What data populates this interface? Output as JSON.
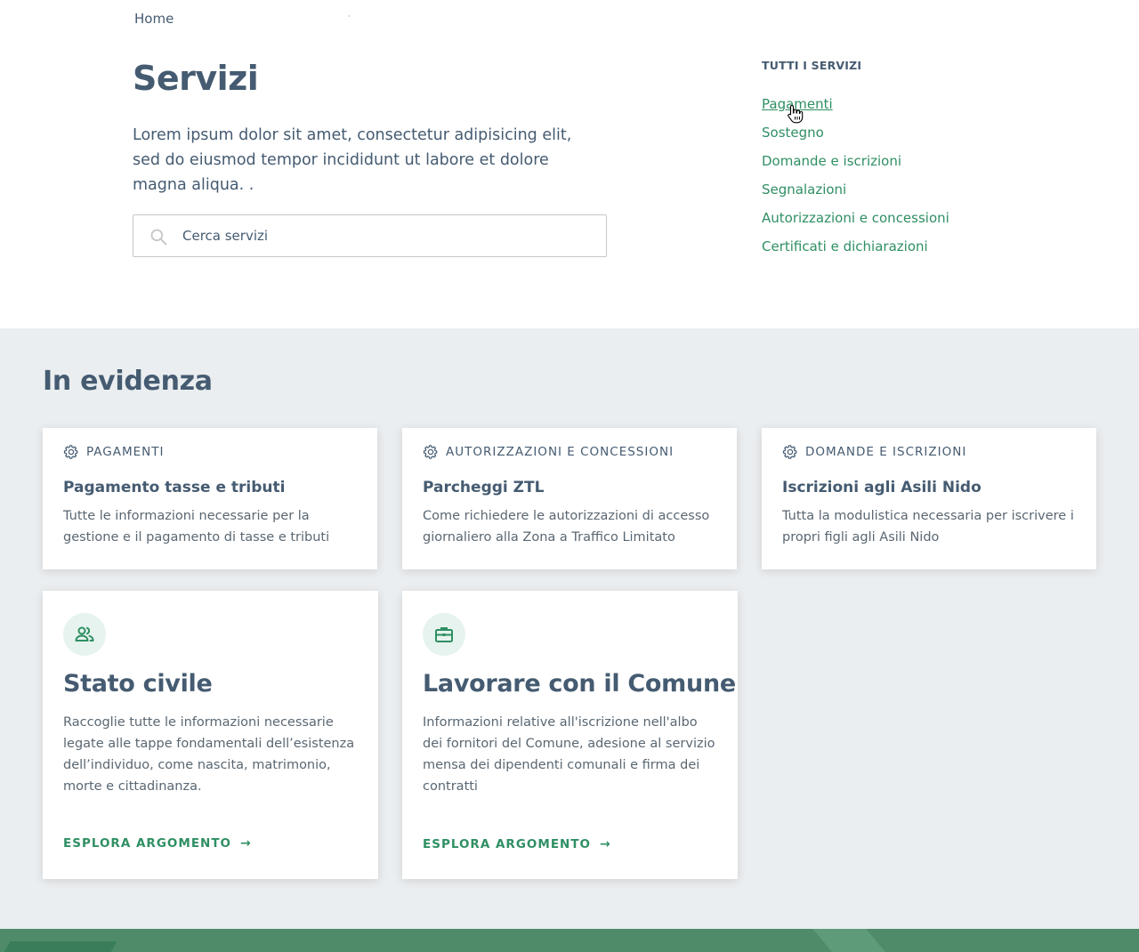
{
  "breadcrumb": {
    "home": "Home",
    "separator": "·"
  },
  "header": {
    "title": "Servizi",
    "lead": "Lorem ipsum dolor sit amet, consectetur adipisicing elit, sed do eiusmod tempor incididunt ut labore et dolore magna aliqua. ."
  },
  "search": {
    "placeholder": "Cerca servizi",
    "value": ""
  },
  "aside": {
    "title": "TUTTI I SERVIZI",
    "items": [
      {
        "label": "Pagamenti"
      },
      {
        "label": "Sostegno"
      },
      {
        "label": "Domande e iscrizioni"
      },
      {
        "label": "Segnalazioni"
      },
      {
        "label": "Autorizzazioni e concessioni"
      },
      {
        "label": "Certificati e dichiarazioni"
      }
    ]
  },
  "evidence": {
    "title": "In evidenza",
    "cards": [
      {
        "category": "PAGAMENTI",
        "title": "Pagamento tasse e tributi",
        "text": "Tutte le informazioni necessarie per la gestione e il pagamento di tasse e tributi",
        "icon": "gear-icon"
      },
      {
        "category": "AUTORIZZAZIONI E CONCESSIONI",
        "title": "Parcheggi ZTL",
        "text": "Come richiedere le autorizzazioni di accesso giornaliero alla Zona a Traffico Limitato",
        "icon": "gear-icon"
      },
      {
        "category": "DOMANDE E ISCRIZIONI",
        "title": "Iscrizioni agli Asili Nido",
        "text": "Tutta la modulistica necessaria per iscrivere i propri figli agli Asili Nido",
        "icon": "gear-icon"
      }
    ],
    "topics": [
      {
        "title": "Stato civile",
        "text": "Raccoglie tutte le informazioni necessarie legate alle tappe fondamentali dell’esistenza dell’individuo, come nascita, matrimonio, morte e cittadinanza.",
        "link": "ESPLORA ARGOMENTO",
        "icon": "people-icon"
      },
      {
        "title": "Lavorare con il Comune",
        "text": "Informazioni relative all'iscrizione nell'albo dei fornitori del Comune, adesione al servizio mensa dei dipendenti comunali e firma dei contratti",
        "link": "ESPLORA ARGOMENTO",
        "icon": "briefcase-icon"
      }
    ]
  },
  "colors": {
    "accent": "#2f8f63",
    "text": "#455b71",
    "section_bg": "#ebeef0",
    "footer": "#4f8a69"
  }
}
